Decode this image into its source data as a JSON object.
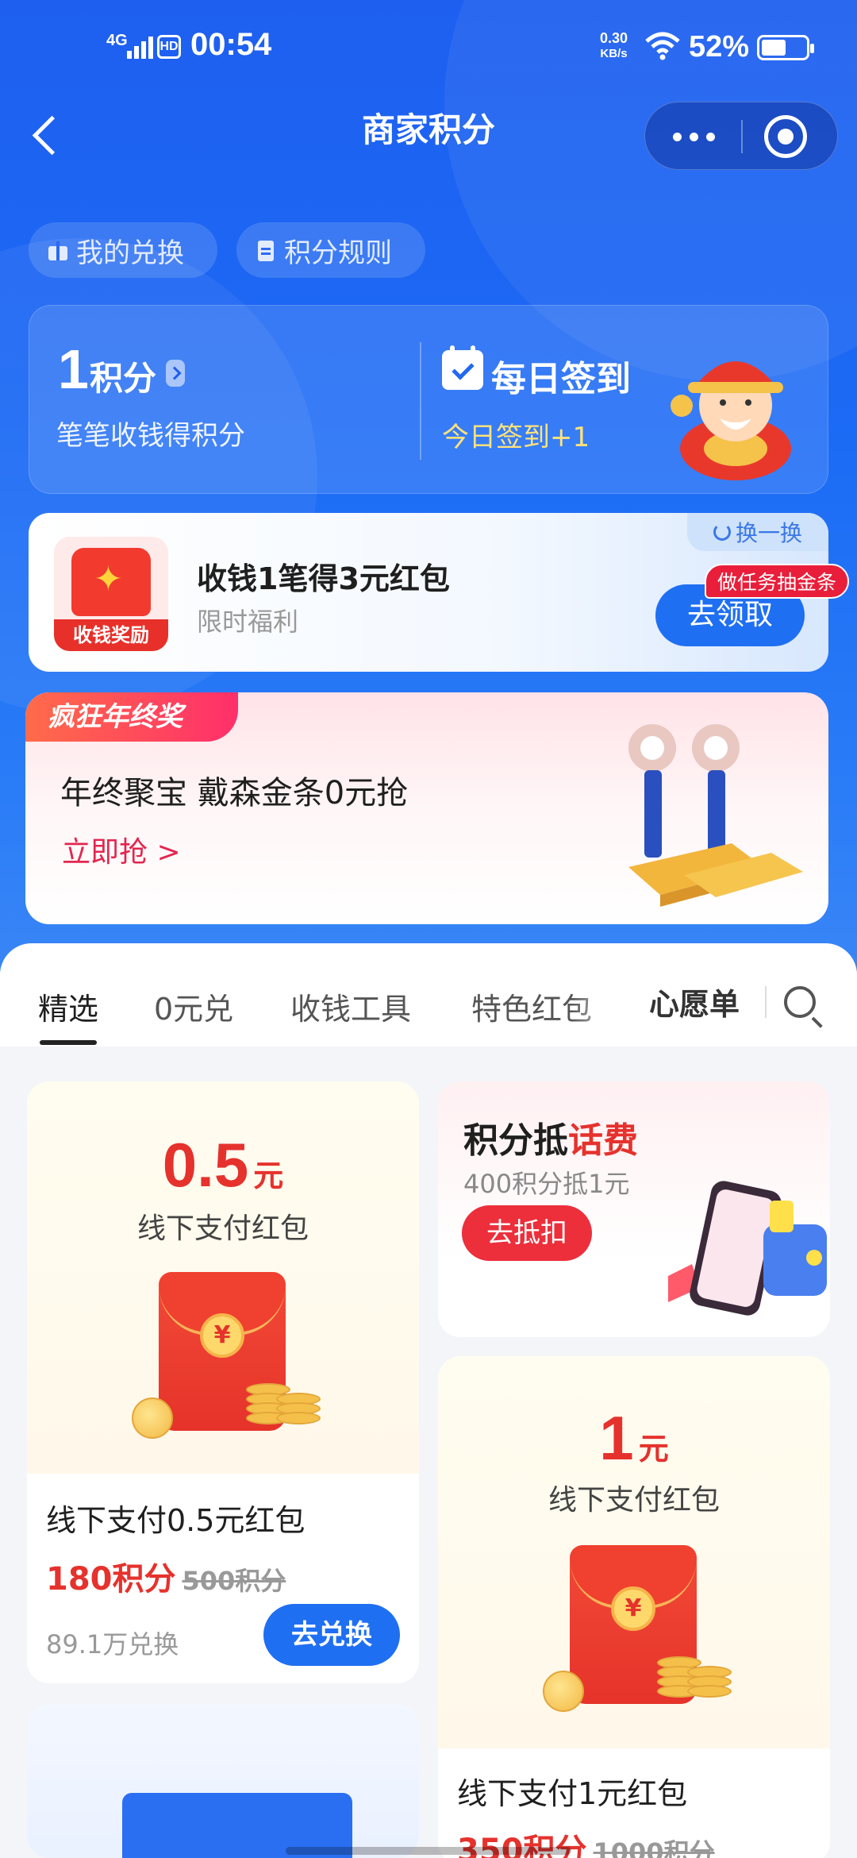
{
  "status_bar": {
    "network": "4G",
    "hd": "HD",
    "time": "00:54",
    "speed_value": "0.30",
    "speed_unit": "KB/s",
    "battery": "52%"
  },
  "nav": {
    "title": "商家积分"
  },
  "quick_links": [
    {
      "label": "我的兑换",
      "icon": "gift-icon"
    },
    {
      "label": "积分规则",
      "icon": "document-icon"
    }
  ],
  "points_card": {
    "points_value": "1",
    "points_unit": "积分",
    "points_subtitle": "笔笔收钱得积分",
    "checkin_title": "每日签到",
    "checkin_subtitle": "今日签到+1"
  },
  "reward_card": {
    "icon_tag": "收钱奖励",
    "title": "收钱1笔得3元红包",
    "subtitle": "限时福利",
    "swap_label": "换一换",
    "claim_button": "去领取",
    "task_badge": "做任务抽金条"
  },
  "banner": {
    "tag": "疯狂年终奖",
    "title": "年终聚宝 戴森金条0元抢",
    "link": "立即抢 >"
  },
  "tabs": [
    {
      "label": "精选",
      "active": true
    },
    {
      "label": "0元兑",
      "active": false
    },
    {
      "label": "收钱工具",
      "active": false
    },
    {
      "label": "特色红包",
      "active": false
    },
    {
      "label": "心愿单",
      "active": false
    }
  ],
  "products": [
    {
      "amount": "0.5",
      "unit": "元",
      "art_desc": "线下支付红包",
      "name": "线下支付0.5元红包",
      "price": "180积分",
      "original_price": "500积分",
      "count": "89.1万兑换",
      "button": "去兑换"
    },
    {
      "amount": "1",
      "unit": "元",
      "art_desc": "线下支付红包",
      "name": "线下支付1元红包",
      "price": "350积分",
      "original_price": "1000积分"
    }
  ],
  "bill_card": {
    "title_part1": "积分抵",
    "title_part2": "话费",
    "subtitle": "400积分抵1元",
    "button": "去抵扣"
  },
  "colors": {
    "brand_blue": "#1f6ff2",
    "price_red": "#e5322d",
    "checkin_yellow": "#ffe27a"
  }
}
